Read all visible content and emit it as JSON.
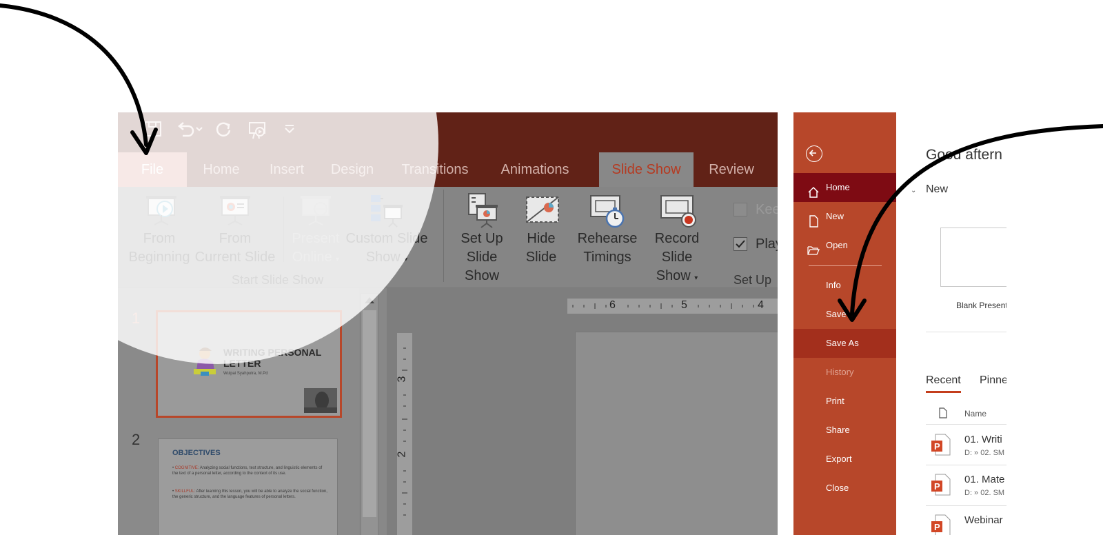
{
  "ppt": {
    "tabs": [
      "File",
      "Home",
      "Insert",
      "Design",
      "Transitions",
      "Animations",
      "Slide Show",
      "Review"
    ],
    "ribbon": {
      "from_beginning": [
        "From",
        "Beginning"
      ],
      "from_current": [
        "From",
        "Current Slide"
      ],
      "present_online": [
        "Present",
        "Online"
      ],
      "custom_show": [
        "Custom Slide",
        "Show"
      ],
      "start_group": "Start Slide Show",
      "setup_show": [
        "Set Up",
        "Slide Show"
      ],
      "hide_slide": [
        "Hide",
        "Slide"
      ],
      "rehearse": [
        "Rehearse",
        "Timings"
      ],
      "record": [
        "Record Slide",
        "Show"
      ],
      "keep_label": "Kee",
      "play_label": "Play",
      "setup_group": "Set Up"
    },
    "slides": [
      {
        "num": "1",
        "title": "WRITING PERSONAL",
        "title2": "LETTER",
        "author": "Wulpai Syahputra, M.Pd"
      },
      {
        "num": "2",
        "title": "OBJECTIVES",
        "b1_label": "COGNITIVE:",
        "b1": "Analyzing social functions, text structure, and linguistic elements of the text of a personal letter, according to the context of its use.",
        "b2_label": "SKILLFUL:",
        "b2": "After learning this lesson, you will be able to analyze the social function, the generic structure, and the language features of personal letters."
      }
    ],
    "ruler_h": [
      "6",
      "5",
      "4"
    ],
    "ruler_v": [
      "3",
      "2"
    ]
  },
  "backstage": {
    "nav": [
      "Home",
      "New",
      "Open",
      "Info",
      "Save",
      "Save As",
      "History",
      "Print",
      "Share",
      "Export",
      "Close"
    ],
    "greeting": "Good aftern",
    "new_label": "New",
    "blank_label": "Blank Present",
    "tabs": [
      "Recent",
      "Pinne"
    ],
    "name_col": "Name",
    "files": [
      {
        "name": "01. Writi",
        "path": "D: » 02. SM"
      },
      {
        "name": "01. Mate",
        "path": "D: » 02. SM"
      },
      {
        "name": "Webinar",
        "path": ""
      }
    ]
  },
  "colors": {
    "ppt_red": "#b7472a",
    "ppt_dark": "#612217",
    "active_home": "#7e0b13",
    "save_as_bg": "#a32f1c",
    "recent_underline": "#c43e1c"
  }
}
